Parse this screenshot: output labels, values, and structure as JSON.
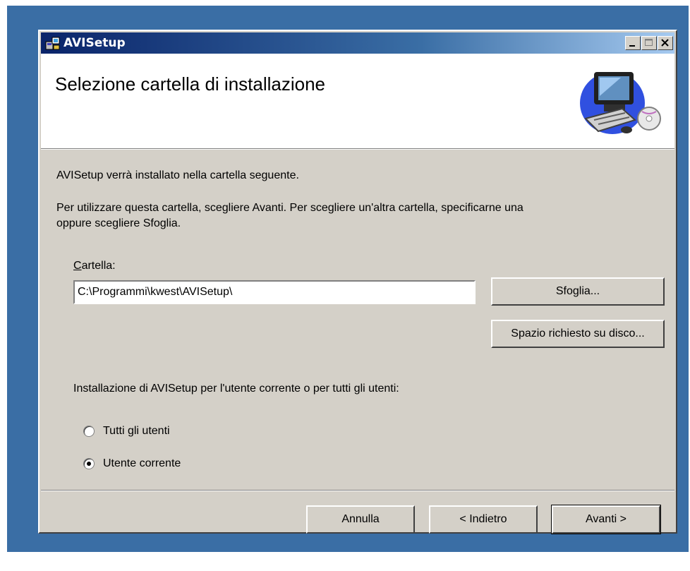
{
  "window": {
    "title": "AVISetup"
  },
  "header": {
    "title": "Selezione cartella di installazione"
  },
  "body": {
    "intro": "AVISetup verrà installato nella cartella seguente.",
    "instructions_line1": "Per utilizzare questa cartella, scegliere Avanti. Per scegliere un'altra cartella, specificarne una",
    "instructions_line2": "oppure scegliere Sfoglia.",
    "folder_label_accesskey": "C",
    "folder_label_rest": "artella:",
    "folder_path": "C:\\Programmi\\kwest\\AVISetup\\",
    "browse_label": "Sfoglia...",
    "disk_cost_label": "Spazio richiesto su disco...",
    "scope_question": "Installazione di AVISetup per l'utente corrente o per tutti gli utenti:",
    "radio_all": "Tutti gli utenti",
    "radio_current": "Utente corrente",
    "selected_scope": "Utente corrente"
  },
  "footer": {
    "cancel": "Annulla",
    "back": "< Indietro",
    "next": "Avanti >"
  },
  "colors": {
    "desktop": "#3a6ea5",
    "face": "#d4d0c8",
    "titlebar_start": "#0a246a"
  }
}
